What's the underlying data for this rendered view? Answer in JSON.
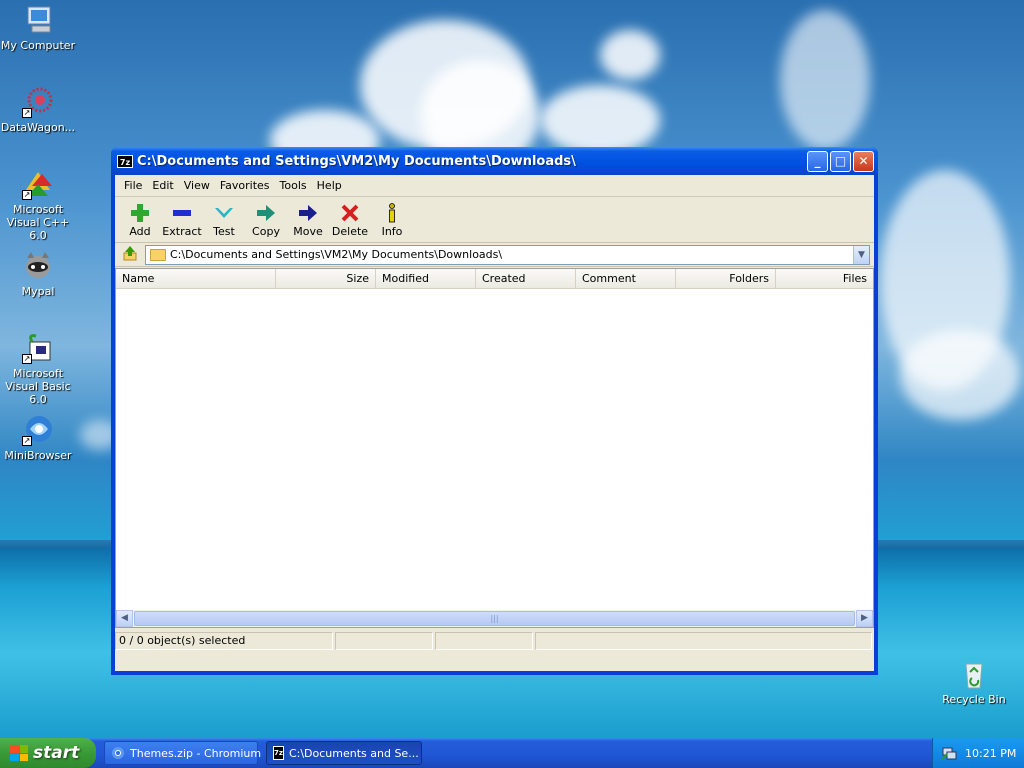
{
  "desktop": {
    "icons": [
      {
        "label": "My Computer"
      },
      {
        "label": "DataWagon..."
      },
      {
        "label": "Microsoft Visual C++ 6.0"
      },
      {
        "label": "Mypal"
      },
      {
        "label": "Microsoft Visual Basic 6.0"
      },
      {
        "label": "MiniBrowser"
      },
      {
        "label": "Recycle Bin"
      }
    ]
  },
  "window": {
    "title": "C:\\Documents and Settings\\VM2\\My Documents\\Downloads\\",
    "app_icon_text": "7z",
    "controls": {
      "minimize": "_",
      "maximize": "□",
      "close": "✕"
    },
    "menu": [
      "File",
      "Edit",
      "View",
      "Favorites",
      "Tools",
      "Help"
    ],
    "toolbar": [
      {
        "label": "Add",
        "icon": "plus-icon",
        "color": "#2ea82e"
      },
      {
        "label": "Extract",
        "icon": "minus-icon",
        "color": "#1d2fd0"
      },
      {
        "label": "Test",
        "icon": "check-icon",
        "color": "#23b5c8"
      },
      {
        "label": "Copy",
        "icon": "arrow-right-icon",
        "color": "#1f8f7a"
      },
      {
        "label": "Move",
        "icon": "arrow-right-icon",
        "color": "#1a1f8f"
      },
      {
        "label": "Delete",
        "icon": "x-icon",
        "color": "#d81f1f"
      },
      {
        "label": "Info",
        "icon": "info-icon",
        "color": "#d6c300"
      }
    ],
    "address": "C:\\Documents and Settings\\VM2\\My Documents\\Downloads\\",
    "columns": [
      "Name",
      "Size",
      "Modified",
      "Created",
      "Comment",
      "Folders",
      "Files"
    ],
    "status": [
      "0 / 0 object(s) selected",
      "",
      "",
      ""
    ]
  },
  "taskbar": {
    "start_label": "start",
    "tasks": [
      {
        "label": "Themes.zip - Chromium",
        "active": false
      },
      {
        "label": "C:\\Documents and Se...",
        "active": true
      }
    ],
    "clock": "10:21 PM"
  }
}
